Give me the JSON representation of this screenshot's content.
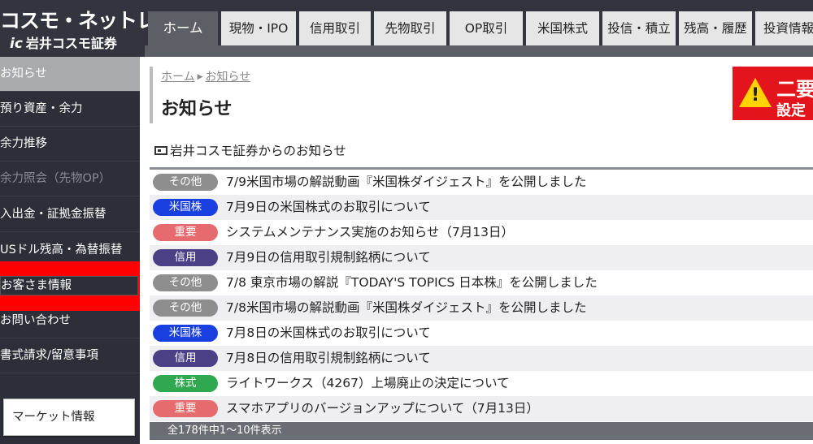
{
  "header": {
    "logo_top": "コスモ・ネットレ",
    "logo_mark": "ic",
    "logo_bottom": "岩井コスモ証券",
    "tabs": [
      {
        "label": "ホーム"
      },
      {
        "label": "現物・IPO"
      },
      {
        "label": "信用取引"
      },
      {
        "label": "先物取引"
      },
      {
        "label": "OP取引"
      },
      {
        "label": "米国株式"
      },
      {
        "label": "投信・積立"
      },
      {
        "label": "残高・履歴"
      },
      {
        "label": "投資情報"
      }
    ]
  },
  "sidebar": {
    "items": [
      {
        "label": "お知らせ"
      },
      {
        "label": "預り資産・余力"
      },
      {
        "label": "余力推移"
      },
      {
        "label": "余力照会（先物OP）"
      },
      {
        "label": "入出金・証拠金振替"
      },
      {
        "label": "USドル残高・為替振替"
      },
      {
        "label": "お客さま情報"
      },
      {
        "label": "お問い合わせ"
      },
      {
        "label": "書式請求/留意事項"
      }
    ],
    "market_button": "マーケット情報"
  },
  "main": {
    "breadcrumb": [
      "ホーム",
      "お知らせ"
    ],
    "page_title": "お知らせ",
    "alert": {
      "line1": "二要",
      "line2": "設定"
    },
    "section_title": "岩井コスモ証券からのお知らせ",
    "news": [
      {
        "category": "その他",
        "color": "#8e8e8e",
        "text": "7/9米国市場の解説動画『米国株ダイジェスト』を公開しました"
      },
      {
        "category": "米国株",
        "color": "#1a3fe0",
        "text": "7月9日の米国株式のお取引について"
      },
      {
        "category": "重要",
        "color": "#e56b6f",
        "text": "システムメンテナンス実施のお知らせ（7月13日）"
      },
      {
        "category": "信用",
        "color": "#4b3f86",
        "text": "7月9日の信用取引規制銘柄について"
      },
      {
        "category": "その他",
        "color": "#8e8e8e",
        "text": "7/8 東京市場の解説『TODAY'S TOPICS 日本株』を公開しました"
      },
      {
        "category": "その他",
        "color": "#8e8e8e",
        "text": "7/8米国市場の解説動画『米国株ダイジェスト』を公開しました"
      },
      {
        "category": "米国株",
        "color": "#1a3fe0",
        "text": "7月8日の米国株式のお取引について"
      },
      {
        "category": "信用",
        "color": "#4b3f86",
        "text": "7月8日の信用取引規制銘柄について"
      },
      {
        "category": "株式",
        "color": "#2fa84f",
        "text": "ライトワークス（4267）上場廃止の決定について"
      },
      {
        "category": "重要",
        "color": "#e56b6f",
        "text": "スマホアプリのバージョンアップについて（7月13日）"
      }
    ],
    "pagination": "全178件中1〜10件表示"
  }
}
